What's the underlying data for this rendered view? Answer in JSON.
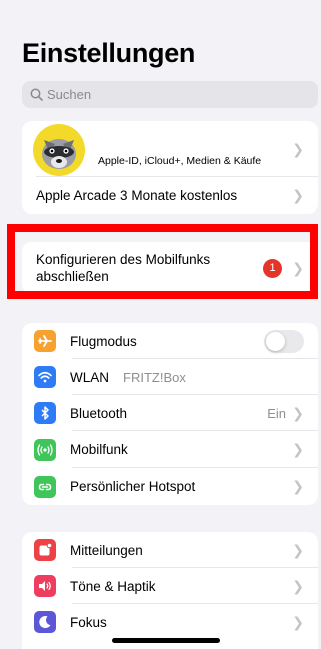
{
  "title": "Einstellungen",
  "search": {
    "placeholder": "Suchen"
  },
  "profile": {
    "subtitle": "Apple-ID, iCloud+, Medien & Käufe",
    "arcade": "Apple Arcade 3 Monate kostenlos"
  },
  "mobile_setup": {
    "line1": "Konfigurieren des Mobilfunks",
    "line2": "abschließen",
    "badge": "1"
  },
  "connectivity": [
    {
      "label": "Flugmodus",
      "icon": "airplane-icon",
      "color": "#f7a12f",
      "toggle": false
    },
    {
      "label": "WLAN",
      "value": "FRITZ!Box",
      "icon": "wifi-icon",
      "color": "#2d7cf6"
    },
    {
      "label": "Bluetooth",
      "value": "Ein",
      "icon": "bluetooth-icon",
      "color": "#2d7cf6"
    },
    {
      "label": "Mobilfunk",
      "icon": "cellular-icon",
      "color": "#3fc55a"
    },
    {
      "label": "Persönlicher Hotspot",
      "icon": "hotspot-icon",
      "color": "#3fc55a"
    }
  ],
  "notifications": [
    {
      "label": "Mitteilungen",
      "icon": "notifications-icon",
      "color": "#ee4146"
    },
    {
      "label": "Töne & Haptik",
      "icon": "sound-icon",
      "color": "#ee3e5f"
    },
    {
      "label": "Fokus",
      "icon": "focus-moon-icon",
      "color": "#5b57d6"
    }
  ],
  "colors": {
    "background": "#f2f2f7",
    "highlight": "#ff0000",
    "badge": "#e5352b"
  }
}
